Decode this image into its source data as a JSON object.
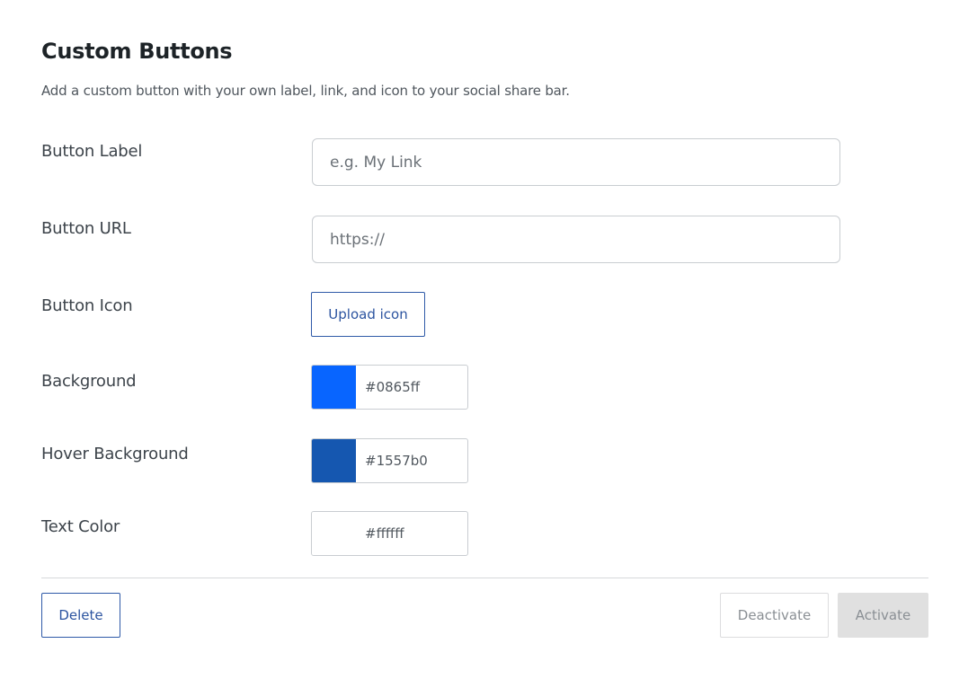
{
  "header": {
    "title": "Custom Buttons",
    "subtitle": "Add a custom button with your own label, link, and icon to your social share bar."
  },
  "form": {
    "button_label": {
      "label": "Button Label",
      "placeholder": "e.g. My Link",
      "value": ""
    },
    "button_url": {
      "label": "Button URL",
      "placeholder": "https://",
      "value": ""
    },
    "button_icon": {
      "label": "Button Icon",
      "upload_label": "Upload icon"
    },
    "background": {
      "label": "Background",
      "value": "#0865ff",
      "swatch": "#0865ff"
    },
    "hover_background": {
      "label": "Hover Background",
      "value": "#1557b0",
      "swatch": "#1557b0"
    },
    "text_color": {
      "label": "Text Color",
      "value": "#ffffff",
      "swatch": "#ffffff"
    }
  },
  "footer": {
    "delete_label": "Delete",
    "deactivate_label": "Deactivate",
    "activate_label": "Activate"
  },
  "colors": {
    "accent": "#2f5aa8",
    "disabled_bg": "#e0e0e0"
  }
}
